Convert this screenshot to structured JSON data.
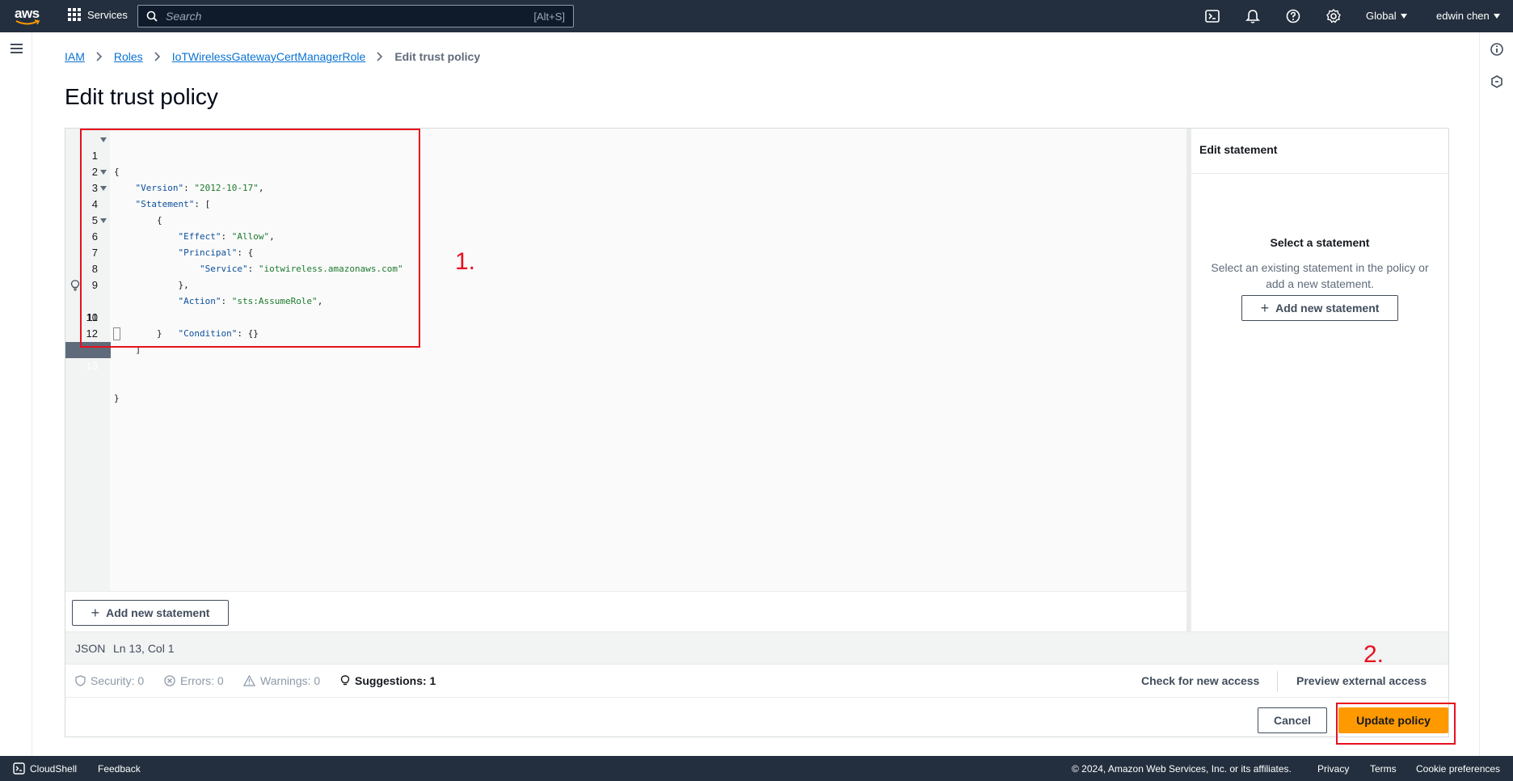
{
  "topnav": {
    "logo_text": "aws",
    "services_label": "Services",
    "search_placeholder": "Search",
    "search_shortcut": "[Alt+S]",
    "region_label": "Global",
    "user_label": "edwin chen"
  },
  "breadcrumb": {
    "items": [
      "IAM",
      "Roles",
      "IoTWirelessGatewayCertManagerRole"
    ],
    "current": "Edit trust policy"
  },
  "page_title": "Edit trust policy",
  "editor": {
    "lines": [
      {
        "n": "1"
      },
      {
        "n": "2"
      },
      {
        "n": "3"
      },
      {
        "n": "4"
      },
      {
        "n": "5"
      },
      {
        "n": "6"
      },
      {
        "n": "7"
      },
      {
        "n": "8"
      },
      {
        "n": "9"
      },
      {
        "n": "10"
      },
      {
        "n": "11"
      },
      {
        "n": "12"
      },
      {
        "n": "13"
      }
    ],
    "tokens": {
      "l1": "{",
      "l2_key": "\"Version\"",
      "l2_val": "\"2012-10-17\"",
      "l3_key": "\"Statement\"",
      "l3_rest": ": [",
      "l4": "{",
      "l5_key": "\"Effect\"",
      "l5_val": "\"Allow\"",
      "l6_key": "\"Principal\"",
      "l6_rest": ": {",
      "l7_key": "\"Service\"",
      "l7_val": "\"iotwireless.amazonaws.com\"",
      "l8": "},",
      "l9_key": "\"Action\"",
      "l9_val": "\"sts:AssumeRole\"",
      "l10_key": "\"Condition\"",
      "l10_rest": ": {}",
      "l11": "}",
      "l12": "]",
      "l13": "}"
    },
    "add_statement_label": "Add new statement",
    "active_line": 13
  },
  "statement_panel": {
    "header": "Edit statement",
    "title": "Select a statement",
    "description": "Select an existing statement in the policy or add a new statement.",
    "add_button_label": "Add new statement"
  },
  "status_bar": {
    "language": "JSON",
    "position": "Ln 13, Col 1"
  },
  "checks": {
    "security": "Security: 0",
    "errors": "Errors: 0",
    "warnings": "Warnings: 0",
    "suggestions": "Suggestions: 1",
    "check_access_label": "Check for new access",
    "preview_access_label": "Preview external access"
  },
  "actions": {
    "cancel_label": "Cancel",
    "update_label": "Update policy"
  },
  "annotations": {
    "label1": "1.",
    "label2": "2."
  },
  "footer": {
    "cloudshell": "CloudShell",
    "feedback": "Feedback",
    "copyright": "© 2024, Amazon Web Services, Inc. or its affiliates.",
    "privacy": "Privacy",
    "terms": "Terms",
    "cookies": "Cookie preferences"
  },
  "colors": {
    "nav_bg": "#232f3e",
    "primary_button": "#ff9900",
    "link": "#0972d3",
    "annotation": "#e8101e"
  }
}
